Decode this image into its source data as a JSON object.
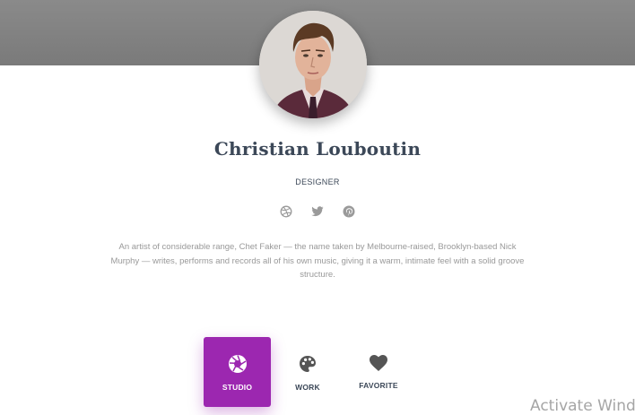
{
  "profile": {
    "name": "Christian Louboutin",
    "role": "DESIGNER",
    "bio": "An artist of considerable range, Chet Faker — the name taken by Melbourne-raised, Brooklyn-based Nick Murphy — writes, performs and records all of his own music, giving it a warm, intimate feel with a solid groove structure."
  },
  "socials": [
    {
      "icon": "dribbble-icon"
    },
    {
      "icon": "twitter-icon"
    },
    {
      "icon": "pinterest-icon"
    }
  ],
  "tabs": [
    {
      "label": "STUDIO",
      "icon": "camera-shutter-icon",
      "active": true
    },
    {
      "label": "WORK",
      "icon": "palette-icon",
      "active": false
    },
    {
      "label": "FAVORITE",
      "icon": "heart-icon",
      "active": false
    }
  ],
  "watermark": {
    "text": "Activate Wind"
  },
  "colors": {
    "accent": "#9c27b0",
    "title": "#3c4858",
    "muted": "#999999",
    "header": "#7f7f7f"
  }
}
